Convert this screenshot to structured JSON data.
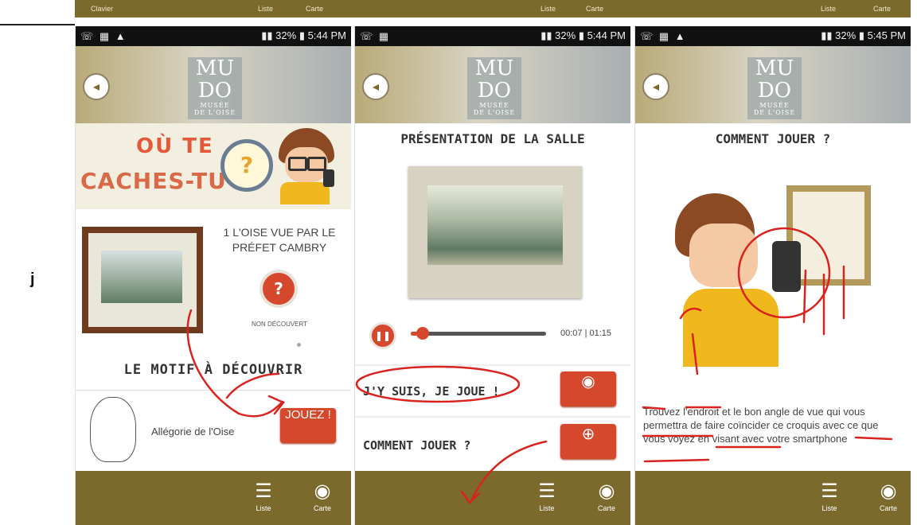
{
  "side_letter": "j",
  "top_strip": {
    "clavier": "Clavier",
    "liste": "Liste",
    "carte": "Carte"
  },
  "panels": [
    {
      "status_left": "☏ ▦ ▲",
      "status_right": "▮▮ 32% ▮ 5:44 PM",
      "logo_top": "MU",
      "logo_mid": "DO",
      "logo_sub": "MUSÉE",
      "logo_sub2": "DE L'OISE",
      "banner_line1": "OÙ TE",
      "banner_line2": "CACHES-TU",
      "banner_q": "?",
      "room_title": "1 L'OISE VUE PAR LE PRÉFET CAMBRY",
      "q_mark": "?",
      "status_text": "NON DÉCOUVERT",
      "motif_title": "LE MOTIF À DÉCOUVRIR",
      "motif_name": "Allégorie de l'Oise",
      "play_label": "JOUEZ !"
    },
    {
      "status_left": "☏ ▦",
      "status_right": "▮▮ 32% ▮ 5:44 PM",
      "title": "PRÉSENTATION DE LA SALLE",
      "time_label": "00:07 | 01:15",
      "progress": 0.09,
      "action1": "J'Y SUIS, JE JOUE !",
      "action2": "COMMENT JOUER ?"
    },
    {
      "status_left": "☏ ▦ ▲",
      "status_right": "▮▮ 32% ▮ 5:45 PM",
      "title": "COMMENT JOUER ?",
      "instructions": "Trouvez l'endroit et le bon angle de vue qui vous permettra de faire coïncider ce croquis avec ce que vous voyez en visant avec votre smartphone"
    }
  ],
  "footer": {
    "list_label": "Liste",
    "map_label": "Carte"
  }
}
